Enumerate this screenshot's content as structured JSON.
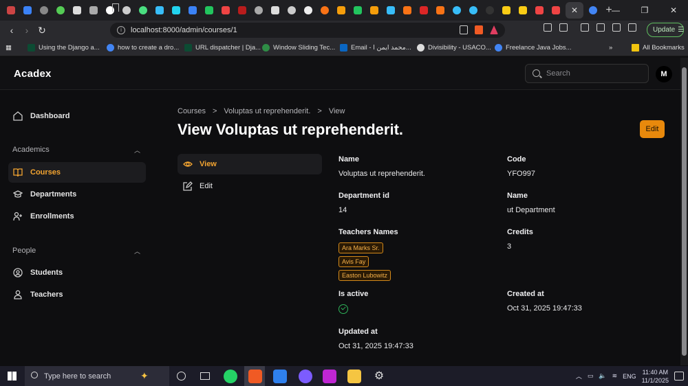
{
  "browser": {
    "url": "localhost:8000/admin/courses/1",
    "update_label": "Update",
    "bookmarks": [
      "Using the Django a...",
      "how to create a dro...",
      "URL dispatcher | Dja...",
      "Window Sliding Tec...",
      "Email - محمد ايمن ا...",
      "Divisibility - USACO...",
      "Freelance Java Jobs..."
    ],
    "all_bookmarks": "All Bookmarks",
    "more_bookmarks": "»"
  },
  "app": {
    "brand": "Acadex",
    "search_placeholder": "Search",
    "avatar_initial": "M"
  },
  "sidebar": {
    "dashboard": "Dashboard",
    "academics_label": "Academics",
    "courses": "Courses",
    "departments": "Departments",
    "enrollments": "Enrollments",
    "people_label": "People",
    "students": "Students",
    "teachers": "Teachers"
  },
  "breadcrumb": {
    "root": "Courses",
    "item": "Voluptas ut reprehenderit.",
    "current": "View",
    "separator": ">"
  },
  "page": {
    "title": "View Voluptas ut reprehenderit.",
    "edit_label": "Edit",
    "subnav_view": "View",
    "subnav_edit": "Edit"
  },
  "fields": {
    "name_label": "Name",
    "name_value": "Voluptas ut reprehenderit.",
    "code_label": "Code",
    "code_value": "YFO997",
    "department_id_label": "Department id",
    "department_id_value": "14",
    "department_name_label": "Name",
    "department_name_value": "ut Department",
    "teachers_label": "Teachers Names",
    "teachers": [
      "Ara Marks Sr.",
      "Avis Fay",
      "Easton Lubowitz"
    ],
    "credits_label": "Credits",
    "credits_value": "3",
    "is_active_label": "Is active",
    "is_active": true,
    "created_at_label": "Created at",
    "created_at_value": "Oct 31, 2025 19:47:33",
    "updated_at_label": "Updated at",
    "updated_at_value": "Oct 31, 2025 19:47:33"
  },
  "taskbar": {
    "search_placeholder": "Type here to search",
    "language": "ENG",
    "time": "11:40 AM",
    "date": "11/1/2025"
  },
  "colors": {
    "accent": "#f4a531",
    "edit_button": "#e8890c",
    "active_check": "#2fb45a"
  }
}
